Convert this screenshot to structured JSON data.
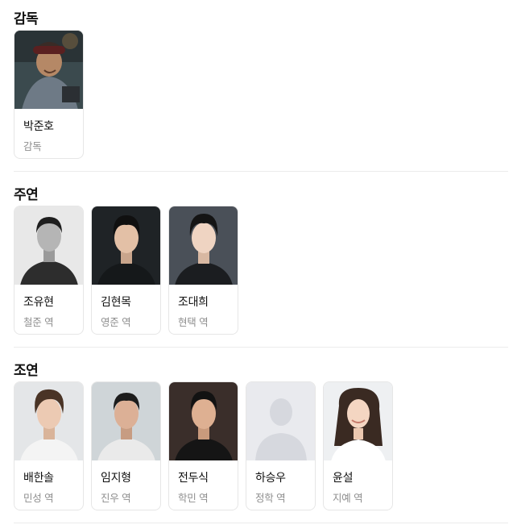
{
  "sections": {
    "director": {
      "title": "감독",
      "people": [
        {
          "name": "박준호",
          "role": "감독"
        }
      ]
    },
    "lead": {
      "title": "주연",
      "people": [
        {
          "name": "조유현",
          "role": "철준 역"
        },
        {
          "name": "김현목",
          "role": "영준 역"
        },
        {
          "name": "조대희",
          "role": "현택 역"
        }
      ]
    },
    "supporting": {
      "title": "조연",
      "people": [
        {
          "name": "배한솔",
          "role": "민성 역"
        },
        {
          "name": "임지형",
          "role": "진우 역"
        },
        {
          "name": "전두식",
          "role": "학민 역"
        },
        {
          "name": "하승우",
          "role": "정학 역"
        },
        {
          "name": "윤설",
          "role": "지예 역"
        }
      ]
    }
  }
}
